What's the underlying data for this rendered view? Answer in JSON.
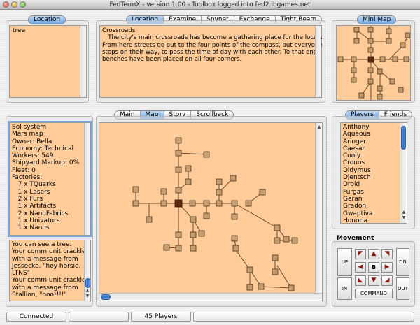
{
  "window": {
    "title": "FedTermX - version 1.00 - Toolbox logged into fed2.ibgames.net"
  },
  "location_panel": {
    "title": "Location",
    "value": "tree"
  },
  "top_tabs": [
    "Location",
    "Examine",
    "Spynet",
    "Exchange",
    "Tight Beam"
  ],
  "top_tabs_active": "Location",
  "description": {
    "lines": [
      "Crossroads",
      "   The city's main crossroads has become a gathering place for the locals.",
      "From here streets go out to the four points of the compass, but everyone",
      "stops on their way, to pass the time of day with each other. To that end,",
      "benches have been placed on all four corners."
    ]
  },
  "mini_map": {
    "title": "Mini Map"
  },
  "info_panel": {
    "lines": [
      "Sol system",
      "Mars map",
      "Owner: Bella",
      "Economy: Technical",
      "Workers: 549",
      "Shipyard Markup: 0%",
      "Fleet: 0",
      "Factories:",
      "   7 x TQuarks",
      "   1 x Lasers",
      "   2 x Furs",
      "   1 x Artifacts",
      "   2 x NanoFabrics",
      "   1 x Univators",
      "   1 x Nanos"
    ]
  },
  "messages": {
    "lines": [
      "You can see a tree.",
      "Your comm unit crackles",
      "with a message from",
      "Jessecka, \"hey horsie,",
      "LTNS\"",
      "Your comm unit crackles",
      "with a message from",
      "Stallion, \"boo!!!!\""
    ]
  },
  "center_tabs": [
    "Main",
    "Map",
    "Story",
    "Scrollback"
  ],
  "center_tabs_active": "Map",
  "right_tabs": [
    "Players",
    "Friends"
  ],
  "right_tabs_active": "Players",
  "players": [
    "Anthony",
    "Aqueous",
    "Aringer",
    "Caesar",
    "Cooly",
    "Cronos",
    "Didymus",
    "Djentsch",
    "Droid",
    "Furgas",
    "Geran",
    "Gradon",
    "Gwaptiva",
    "Honoria"
  ],
  "movement": {
    "title": "Movement",
    "up": "UP",
    "dn": "DN",
    "in": "IN",
    "out": "OUT",
    "command": "COMMAND",
    "center": "B",
    "icons": [
      "north-west-arrow",
      "north-arrow",
      "north-east-arrow",
      "west-arrow",
      "east-arrow",
      "south-west-arrow",
      "south-arrow",
      "south-east-arrow"
    ]
  },
  "status_bar": {
    "connection": "Connected",
    "players": "45 Players",
    "field1": "",
    "field3": ""
  },
  "colors": {
    "pane": "#ffcc99",
    "node": "#c69c6d",
    "current_node": "#5a2a0a",
    "accent": "#6fa4e0"
  }
}
